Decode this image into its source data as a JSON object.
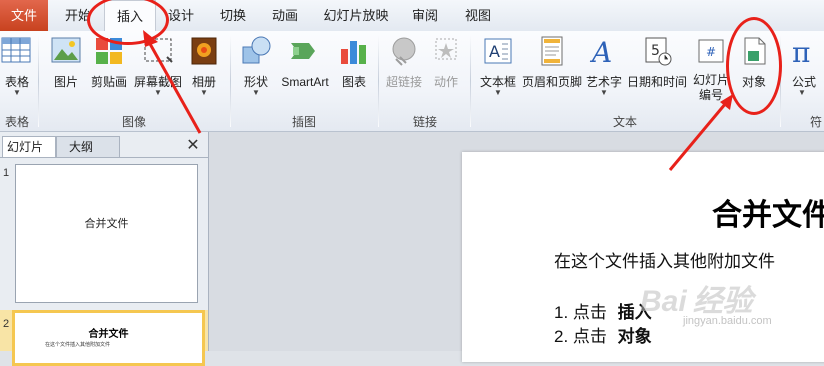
{
  "tabs": {
    "file": "文件",
    "home": "开始",
    "insert": "插入",
    "design": "设计",
    "transitions": "切换",
    "animations": "动画",
    "slideshow": "幻灯片放映",
    "review": "审阅",
    "view": "视图"
  },
  "ribbon": {
    "tables": {
      "group": "表格",
      "table": "表格"
    },
    "images": {
      "group": "图像",
      "picture": "图片",
      "clipart": "剪贴画",
      "screenshot": "屏幕截图",
      "album": "相册"
    },
    "illustrations": {
      "group": "插图",
      "shapes": "形状",
      "smartart": "SmartArt",
      "chart": "图表"
    },
    "links": {
      "group": "链接",
      "hyperlink": "超链接",
      "action": "动作"
    },
    "text": {
      "group": "文本",
      "textbox": "文本框",
      "header_footer": "页眉和页脚",
      "wordart": "艺术字",
      "datetime": "日期和时间",
      "slide_number_1": "幻灯片",
      "slide_number_2": "编号",
      "object": "对象"
    },
    "symbols": {
      "group": "符",
      "equation": "公式",
      "calendar_day": "5"
    }
  },
  "panel": {
    "tab_slides": "幻灯片",
    "tab_outline": "大纲",
    "slide1_number": "1",
    "slide1_title": "合并文件",
    "slide2_number": "2",
    "slide2_title": "合并文件",
    "slide2_line": "在这个文件插入其他附加文件"
  },
  "slide": {
    "title": "合并文件",
    "body": "在这个文件插入其他附加文件",
    "step1_prefix": "1. 点击",
    "step1_bold": "插入",
    "step2_prefix": "2. 点击",
    "step2_bold": "对象"
  },
  "watermark": {
    "brand": "Bai",
    "brand2": "经验",
    "url": "jingyan.baidu.com"
  },
  "colors": {
    "annotation_red": "#e8211a",
    "file_tab": "#c8421f",
    "selected_slide_border": "#f5c750"
  }
}
